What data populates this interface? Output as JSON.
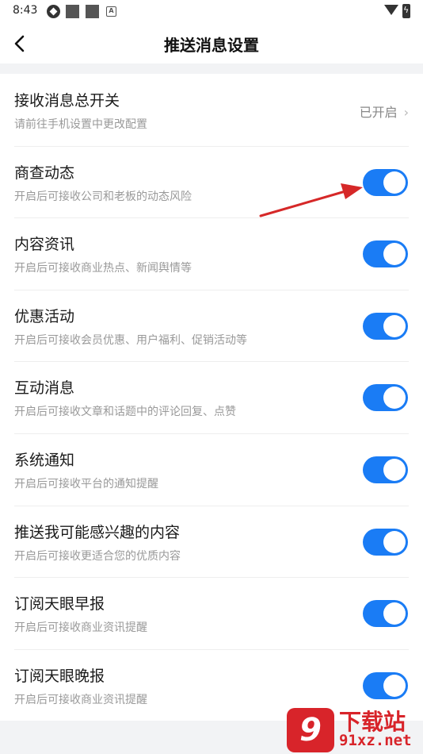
{
  "status_bar": {
    "time": "8:43",
    "icons": [
      "gear-icon",
      "square-icon",
      "square-icon",
      "a-icon",
      "wifi-icon",
      "battery-charging-icon"
    ]
  },
  "header": {
    "back_icon": "chevron-left-icon",
    "title": "推送消息设置"
  },
  "settings": [
    {
      "title": "接收消息总开关",
      "desc": "请前往手机设置中更改配置",
      "value": "已开启",
      "control": "chevron-right-icon"
    },
    {
      "title": "商查动态",
      "desc": "开启后可接收公司和老板的动态风险",
      "toggle": true
    },
    {
      "title": "内容资讯",
      "desc": "开启后可接收商业热点、新闻舆情等",
      "toggle": true
    },
    {
      "title": "优惠活动",
      "desc": "开启后可接收会员优惠、用户福利、促销活动等",
      "toggle": true
    },
    {
      "title": "互动消息",
      "desc": "开启后可接收文章和话题中的评论回复、点赞",
      "toggle": true
    },
    {
      "title": "系统通知",
      "desc": "开启后可接收平台的通知提醒",
      "toggle": true
    },
    {
      "title": "推送我可能感兴趣的内容",
      "desc": "开启后可接收更适合您的优质内容",
      "toggle": true
    },
    {
      "title": "订阅天眼早报",
      "desc": "开启后可接收商业资讯提醒",
      "toggle": true
    },
    {
      "title": "订阅天眼晚报",
      "desc": "开启后可接收商业资讯提醒",
      "toggle": true
    }
  ],
  "colors": {
    "toggle_on": "#1a7cf5",
    "annotation_arrow": "#d62828",
    "watermark": "#d8242a"
  },
  "watermark": {
    "logo_text": "9",
    "title": "下载站",
    "domain": "91xz.net"
  }
}
